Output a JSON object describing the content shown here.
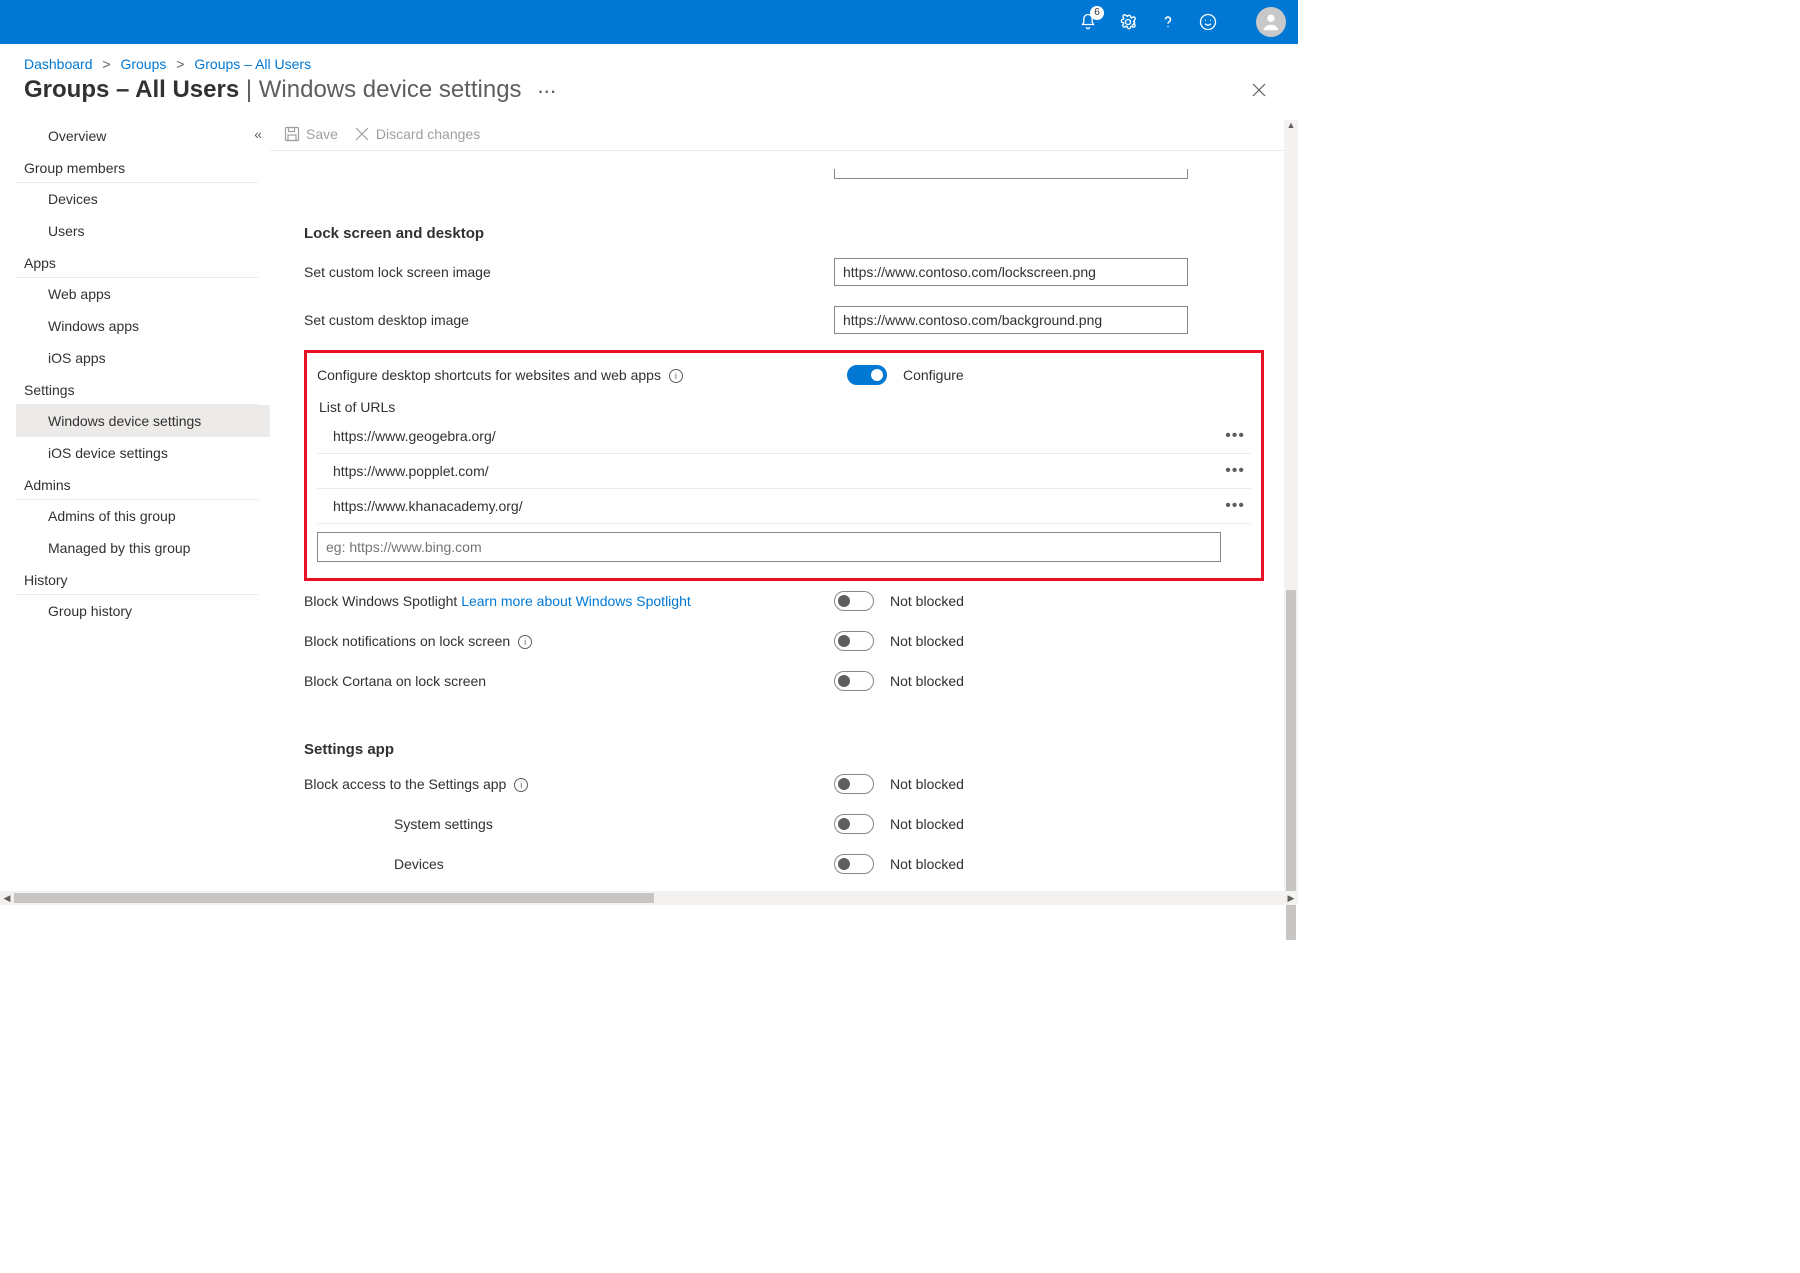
{
  "topbar": {
    "notification_count": "6"
  },
  "breadcrumbs": {
    "items": [
      "Dashboard",
      "Groups",
      "Groups – All Users"
    ]
  },
  "page_title": {
    "left": "Groups – All Users",
    "sep": " | ",
    "right": "Windows device settings"
  },
  "toolbar": {
    "save": "Save",
    "discard": "Discard changes"
  },
  "sidebar": {
    "groups": [
      {
        "items": [
          {
            "label": "Overview"
          }
        ]
      },
      {
        "header": "Group members",
        "items": [
          {
            "label": "Devices"
          },
          {
            "label": "Users"
          }
        ]
      },
      {
        "header": "Apps",
        "items": [
          {
            "label": "Web apps"
          },
          {
            "label": "Windows apps"
          },
          {
            "label": "iOS apps"
          }
        ]
      },
      {
        "header": "Settings",
        "items": [
          {
            "label": "Windows device settings",
            "active": true
          },
          {
            "label": "iOS device settings"
          }
        ]
      },
      {
        "header": "Admins",
        "items": [
          {
            "label": "Admins of this group"
          },
          {
            "label": "Managed by this group"
          }
        ]
      },
      {
        "header": "History",
        "items": [
          {
            "label": "Group history"
          }
        ]
      }
    ]
  },
  "lockscreen": {
    "section": "Lock screen and desktop",
    "lock_img_label": "Set custom lock screen image",
    "lock_img_value": "https://www.contoso.com/lockscreen.png",
    "desktop_img_label": "Set custom desktop image",
    "desktop_img_value": "https://www.contoso.com/background.png",
    "shortcuts_label": "Configure desktop shortcuts for websites and web apps",
    "shortcuts_toggle_label": "Configure",
    "list_urls_hdr": "List of URLs",
    "urls": [
      "https://www.geogebra.org/",
      "https://www.popplet.com/",
      "https://www.khanacademy.org/"
    ],
    "url_placeholder": "eg: https://www.bing.com",
    "spotlight_label": "Block Windows Spotlight ",
    "spotlight_link": "Learn more about Windows Spotlight",
    "spotlight_state": "Not blocked",
    "notif_label": "Block notifications on lock screen",
    "notif_state": "Not blocked",
    "cortana_label": "Block Cortana on lock screen",
    "cortana_state": "Not blocked"
  },
  "settings_app": {
    "section": "Settings app",
    "block_label": "Block access to the Settings app",
    "block_state": "Not blocked",
    "system_label": "System settings",
    "system_state": "Not blocked",
    "devices_label": "Devices",
    "devices_state": "Not blocked"
  }
}
